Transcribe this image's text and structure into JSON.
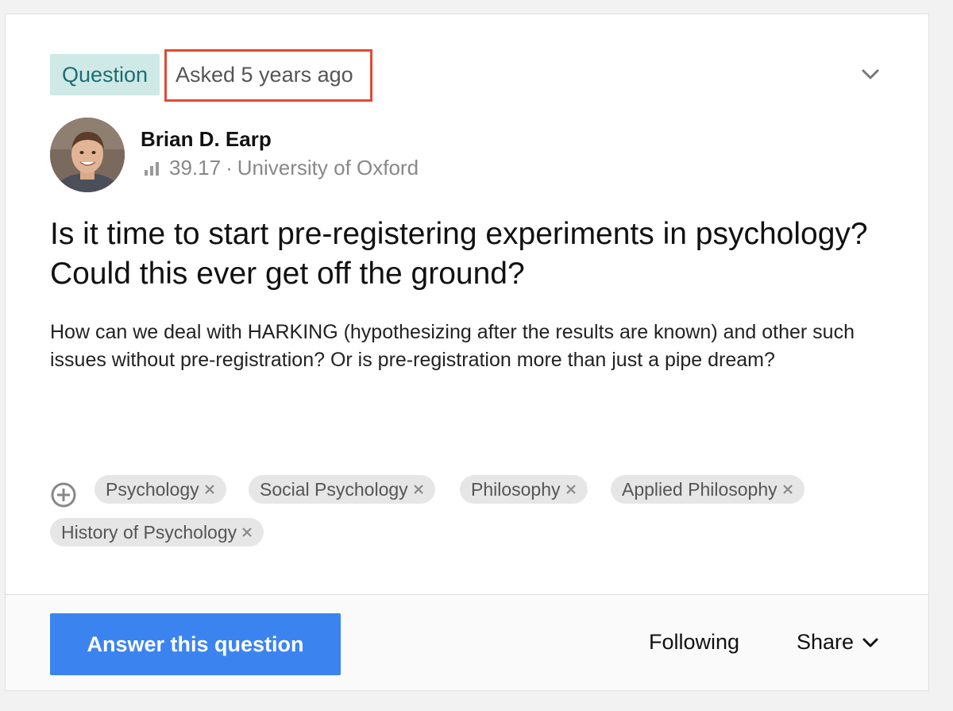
{
  "header": {
    "badge_label": "Question",
    "asked_text": "Asked 5 years ago",
    "menu_icon": "chevron-down-icon"
  },
  "author": {
    "name": "Brian D. Earp",
    "score": "39.17",
    "separator": "·",
    "institution": "University of Oxford",
    "score_icon": "bar-chart-icon"
  },
  "question": {
    "title": "Is it time to start pre-registering experiments in psychology? Could this ever get off the ground?",
    "description": "How can we deal with HARKING (hypothesizing after the results are known) and other such issues without pre-registration? Or is pre-registration more than just a pipe dream?"
  },
  "topics": {
    "add_icon": "add-circle-icon",
    "tags": [
      {
        "label": "Psychology"
      },
      {
        "label": "Social Psychology"
      },
      {
        "label": "Philosophy"
      },
      {
        "label": "Applied Philosophy"
      },
      {
        "label": "History of Psychology"
      }
    ]
  },
  "footer": {
    "answer_label": "Answer this question",
    "following_label": "Following",
    "share_label": "Share"
  },
  "colors": {
    "badge_bg": "#cfe9e6",
    "badge_text": "#1d6e72",
    "highlight_box": "#e04b35",
    "primary_button": "#3b84f0",
    "tag_bg": "#e6e6e6"
  }
}
